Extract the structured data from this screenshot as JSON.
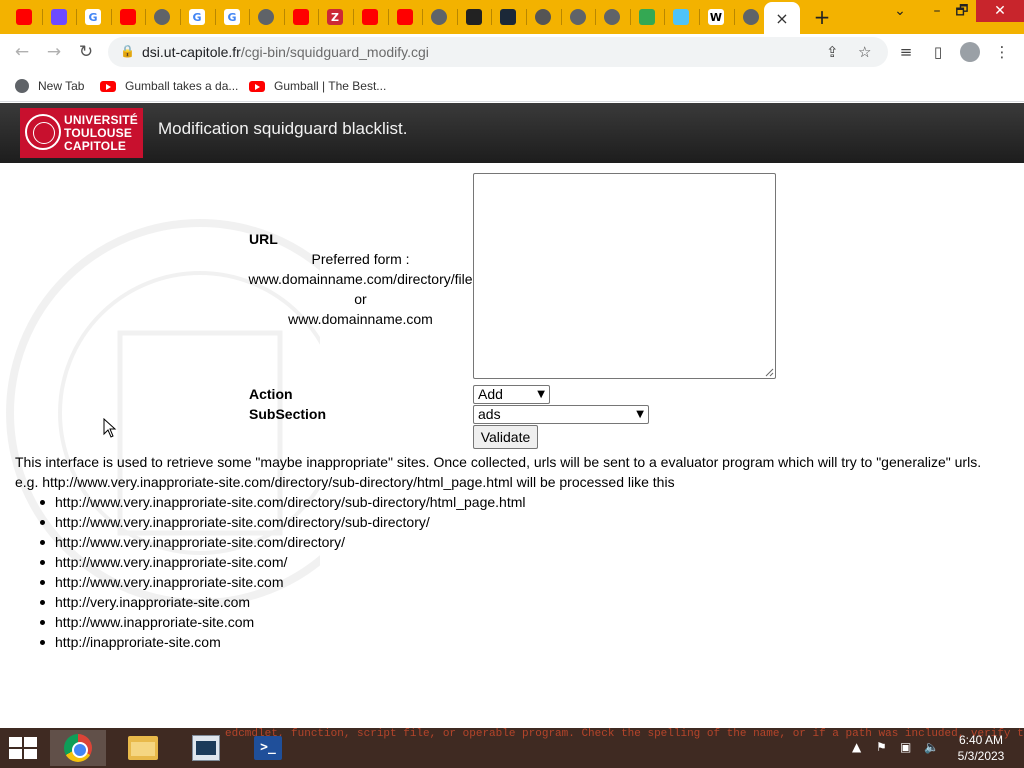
{
  "browser": {
    "active_tab_close": "×",
    "new_tab": "+",
    "tab_menu": "⌄",
    "window": {
      "restore": "🗗",
      "close": "✕"
    },
    "address": {
      "host": "dsi.ut-capitole.fr",
      "path": "/cgi-bin/squidguard_modify.cgi"
    },
    "bookmarks": [
      {
        "label": "New Tab",
        "icon": "globe-icon"
      },
      {
        "label": "Gumball takes a da...",
        "icon": "youtube-icon"
      },
      {
        "label": "Gumball | The Best...",
        "icon": "youtube-icon"
      }
    ],
    "tab_icons": [
      "youtube-icon",
      "proton-icon",
      "google-icon",
      "youtube-icon",
      "globe-icon",
      "google-icon",
      "google-icon",
      "globe-icon",
      "youtube-icon",
      "zotero-icon",
      "youtube-icon",
      "youtube-icon",
      "globe-icon",
      "audio-icon",
      "steam-icon",
      "chrome-icon",
      "gear-icon",
      "globe-icon",
      "maps-icon",
      "page-icon",
      "wikipedia-icon",
      "globe-icon"
    ],
    "tab_letters": {
      "google": "G",
      "zotero": "Z",
      "wikipedia": "W"
    }
  },
  "header": {
    "logo_lines": [
      "UNIVERSITÉ",
      "TOULOUSE",
      "CAPITOLE"
    ],
    "title": "Modification squidguard blacklist."
  },
  "form": {
    "url_label": "URL",
    "hint_lines": [
      "Preferred form :",
      "www.domainname.com/directory/file",
      "or",
      "www.domainname.com"
    ],
    "url_value": "",
    "action_label": "Action",
    "action_value": "Add",
    "subsection_label": "SubSection",
    "subsection_value": "ads",
    "validate_label": "Validate"
  },
  "description": {
    "line1": "This interface is used to retrieve some \"maybe inappropriate\" sites. Once collected, urls will be sent to a evaluator program which will try to \"generalize\" urls.",
    "line2": "e.g. http://www.very.inapproriate-site.com/directory/sub-directory/html_page.html will be processed like this",
    "examples": [
      "http://www.very.inapproriate-site.com/directory/sub-directory/html_page.html",
      "http://www.very.inapproriate-site.com/directory/sub-directory/",
      "http://www.very.inapproriate-site.com/directory/",
      "http://www.very.inapproriate-site.com/",
      "http://www.very.inapproriate-site.com",
      "http://very.inapproriate-site.com",
      "http://www.inapproriate-site.com",
      "http://inapproriate-site.com"
    ]
  },
  "taskbar": {
    "time": "6:40 AM",
    "date": "5/3/2023",
    "ps_glyph": ">_",
    "background_text": "edcmdlet, function, script file, or operable program. Check the spelling of the name, or if a path was included, verify that the path is correct and try again."
  },
  "colors": {
    "tabstrip": "#f3b200",
    "header_bar": "#2b2b2b",
    "logo_red": "#c8102e",
    "taskbar": "#3f2a22"
  }
}
